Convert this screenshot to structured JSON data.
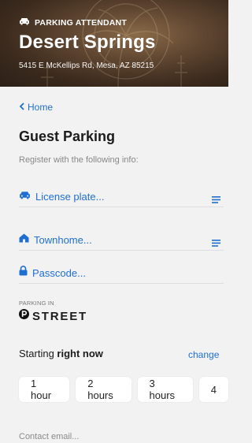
{
  "header": {
    "badge": "PARKING ATTENDANT",
    "location_name": "Desert Springs",
    "address": "5415 E McKellips Rd, Mesa, AZ 85215"
  },
  "nav": {
    "back_label": "Home"
  },
  "page": {
    "title": "Guest Parking",
    "subtitle": "Register with the following info:"
  },
  "fields": {
    "license_plate": "License plate...",
    "townhome": "Townhome...",
    "passcode": "Passcode..."
  },
  "parking": {
    "heading": "PARKING IN",
    "zone": "STREET"
  },
  "start": {
    "prefix": "Starting ",
    "time": "right now",
    "change_label": "change"
  },
  "durations": [
    "1 hour",
    "2 hours",
    "3 hours",
    "4"
  ],
  "contact": {
    "placeholder": "Contact email..."
  },
  "colors": {
    "accent": "#1f6fd1",
    "background": "#f2f2f2",
    "hero": "#4a3624"
  },
  "icons": {
    "car": "car-icon",
    "home": "home-icon",
    "lock": "lock-icon",
    "list": "list-icon",
    "parking": "parking-p-icon",
    "back": "chevron-left-icon"
  }
}
